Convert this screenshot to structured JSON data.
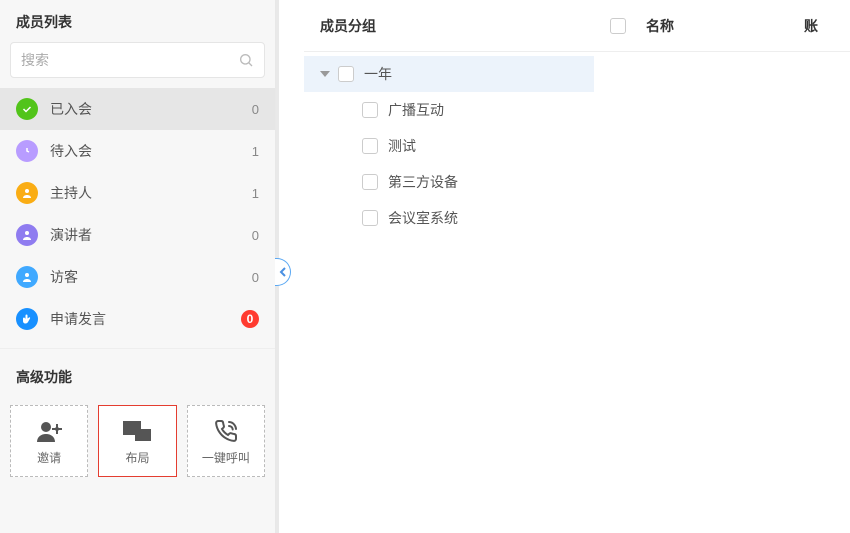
{
  "sidebar": {
    "title": "成员列表",
    "search_placeholder": "搜索",
    "categories": [
      {
        "id": "joined",
        "label": "已入会",
        "count": "0",
        "color": "#52c41a"
      },
      {
        "id": "pending",
        "label": "待入会",
        "count": "1",
        "color": "#b89cff"
      },
      {
        "id": "host",
        "label": "主持人",
        "count": "1",
        "color": "#faad14"
      },
      {
        "id": "speaker",
        "label": "演讲者",
        "count": "0",
        "color": "#8f7cf0"
      },
      {
        "id": "guest",
        "label": "访客",
        "count": "0",
        "color": "#40a9ff"
      },
      {
        "id": "request",
        "label": "申请发言",
        "count": "0",
        "color": "#1890ff",
        "countStyle": "badge"
      }
    ],
    "advanced_title": "高级功能",
    "actions": {
      "invite": "邀请",
      "layout": "布局",
      "call_all": "一键呼叫"
    }
  },
  "groups": {
    "title": "成员分组",
    "root": {
      "label": "一年",
      "children": [
        {
          "label": "广播互动"
        },
        {
          "label": "测试"
        },
        {
          "label": "第三方设备"
        },
        {
          "label": "会议室系统"
        }
      ]
    }
  },
  "table": {
    "col_name": "名称",
    "col_account": "账"
  }
}
